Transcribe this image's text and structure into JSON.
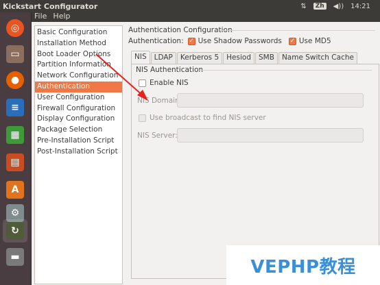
{
  "topbar": {
    "title": "Kickstart Configurator",
    "keyboard": "Zh",
    "sort_icon": "⇅",
    "volume_icon": "◀))",
    "time": "14:21"
  },
  "menu": {
    "file": "File",
    "help": "Help"
  },
  "launcher": [
    {
      "name": "ubuntu-dash-icon",
      "color": "#e95420"
    },
    {
      "name": "files-icon",
      "color": "#8a6e5e"
    },
    {
      "name": "firefox-icon",
      "color": "#e66000"
    },
    {
      "name": "writer-icon",
      "color": "#2a6ebb"
    },
    {
      "name": "calc-icon",
      "color": "#3e9a39"
    },
    {
      "name": "impress-icon",
      "color": "#c94d20"
    },
    {
      "name": "software-center-icon",
      "color": "#e0731c"
    },
    {
      "name": "system-settings-icon",
      "color": "#7f8c8d"
    },
    {
      "name": "terminal-icon",
      "color": "#505b3a"
    },
    {
      "name": "dvd-icon",
      "color": "#7a7a7a"
    }
  ],
  "nav": {
    "items": [
      "Basic Configuration",
      "Installation Method",
      "Boot Loader Options",
      "Partition Information",
      "Network Configuration",
      "Authentication",
      "User Configuration",
      "Firewall Configuration",
      "Display Configuration",
      "Package Selection",
      "Pre-Installation Script",
      "Post-Installation Script"
    ],
    "selected": "Authentication"
  },
  "auth": {
    "section_title": "Authentication Configuration",
    "label": "Authentication:",
    "shadow_label": "Use Shadow Passwords",
    "shadow_checked": true,
    "md5_label": "Use MD5",
    "md5_checked": true
  },
  "tabs": [
    "NIS",
    "LDAP",
    "Kerberos 5",
    "Hesiod",
    "SMB",
    "Name Switch Cache"
  ],
  "active_tab": "NIS",
  "nis": {
    "group_title": "NIS Authentication",
    "enable_label": "Enable NIS",
    "enable_checked": false,
    "domain_label": "NIS Domain:",
    "domain_value": "",
    "broadcast_label": "Use broadcast to find NIS server",
    "broadcast_checked": false,
    "server_label": "NIS Server:",
    "server_value": ""
  },
  "watermark": "VEPHP教程",
  "colors": {
    "accent": "#f07746",
    "launcher_bg": "#4a3d42",
    "topbar_bg": "#3c3b37",
    "watermark": "#3a8fd9"
  }
}
